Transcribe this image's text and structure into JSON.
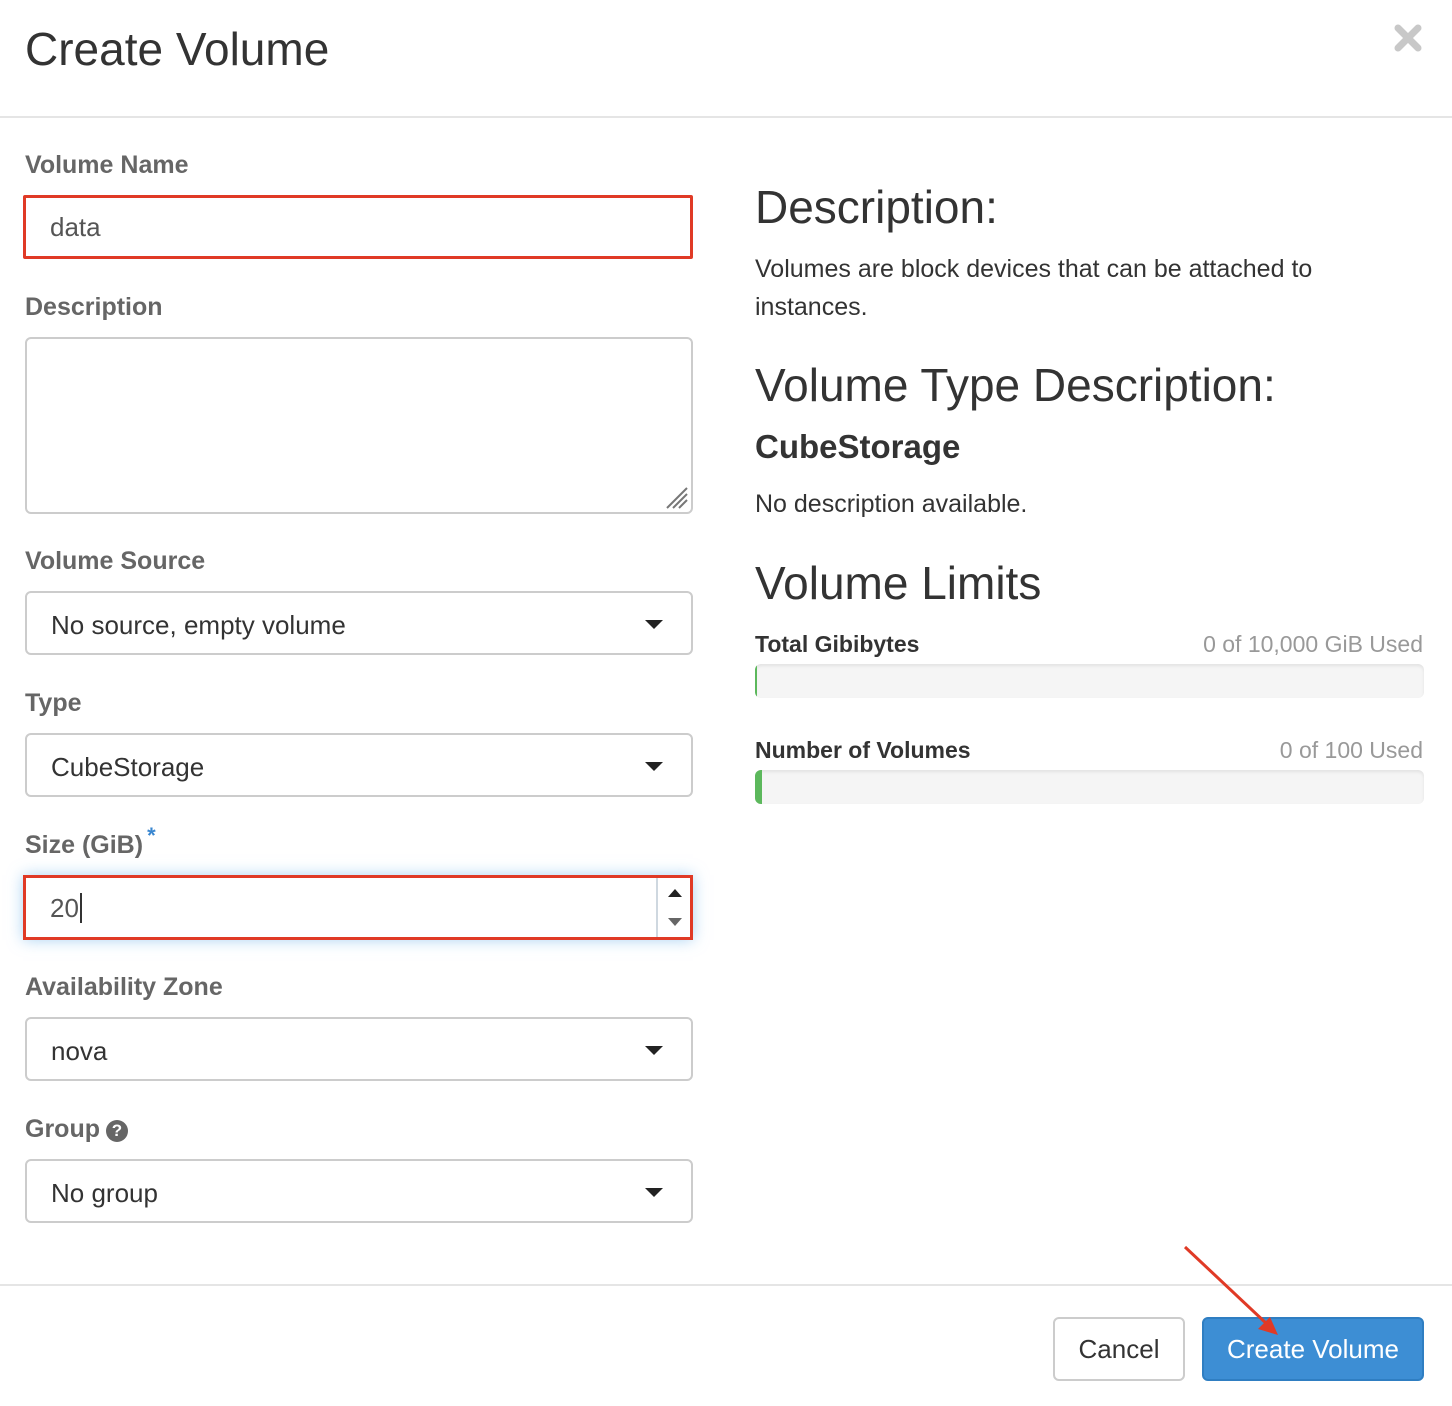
{
  "dialog": {
    "title": "Create Volume",
    "close_icon": "close-icon"
  },
  "form": {
    "volume_name": {
      "label": "Volume Name",
      "value": "data"
    },
    "description": {
      "label": "Description",
      "value": ""
    },
    "volume_source": {
      "label": "Volume Source",
      "selected": "No source, empty volume"
    },
    "type": {
      "label": "Type",
      "selected": "CubeStorage"
    },
    "size": {
      "label": "Size (GiB)",
      "required_marker": "*",
      "value": "20"
    },
    "availability_zone": {
      "label": "Availability Zone",
      "selected": "nova"
    },
    "group": {
      "label": "Group",
      "help_icon": "question-circle-icon",
      "selected": "No group"
    }
  },
  "info": {
    "description_heading": "Description:",
    "description_text": "Volumes are block devices that can be attached to instances.",
    "type_heading": "Volume Type Description:",
    "type_name": "CubeStorage",
    "type_text": "No description available.",
    "limits_heading": "Volume Limits",
    "limits": [
      {
        "label": "Total Gibibytes",
        "used_text": "0 of 10,000 GiB Used",
        "fraction": 0.0
      },
      {
        "label": "Number of Volumes",
        "used_text": "0 of 100 Used",
        "fraction": 0.01
      }
    ],
    "progress_color": "#5cb85c"
  },
  "footer": {
    "cancel_label": "Cancel",
    "submit_label": "Create Volume"
  },
  "colors": {
    "primary": "#3d8ed4",
    "highlight_border": "#e03a26",
    "required_star": "#3a87d0"
  }
}
